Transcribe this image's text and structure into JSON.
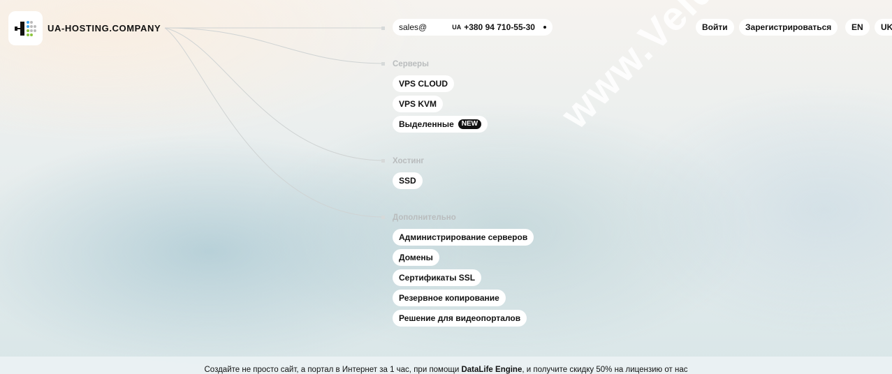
{
  "brand": {
    "name": "UA-HOSTING.COMPANY",
    "logo_icon": "server-rack-logo-icon"
  },
  "contact": {
    "email": "sales@",
    "country_tag": "UA",
    "phone": "+380 94 710-55-30"
  },
  "auth": {
    "login_label": "Войти",
    "register_label": "Зарегистрироваться"
  },
  "languages": [
    "EN",
    "UK"
  ],
  "menu": {
    "servers": {
      "title": "Серверы",
      "items": [
        "VPS CLOUD",
        "VPS KVM",
        "Выделенные"
      ],
      "badge": "NEW"
    },
    "hosting": {
      "title": "Хостинг",
      "items": [
        "SSD"
      ]
    },
    "extra": {
      "title": "Дополнительно",
      "items": [
        "Администрирование серверов",
        "Домены",
        "Сертификаты SSL",
        "Резервное копирование",
        "Решение для видеопорталов"
      ]
    }
  },
  "watermark": "www.Veldc.com",
  "footer": {
    "text_before": "Создайте не просто сайт, а портал в Интернет за 1 час, при помощи ",
    "product": "DataLife Engine",
    "text_after": ", и получите скидку 50% на лицензию от нас"
  },
  "colors": {
    "accent_green": "#8dc63f",
    "accent_blue": "#3fa9f5",
    "text": "#111111",
    "muted": "#b9bcbd"
  }
}
